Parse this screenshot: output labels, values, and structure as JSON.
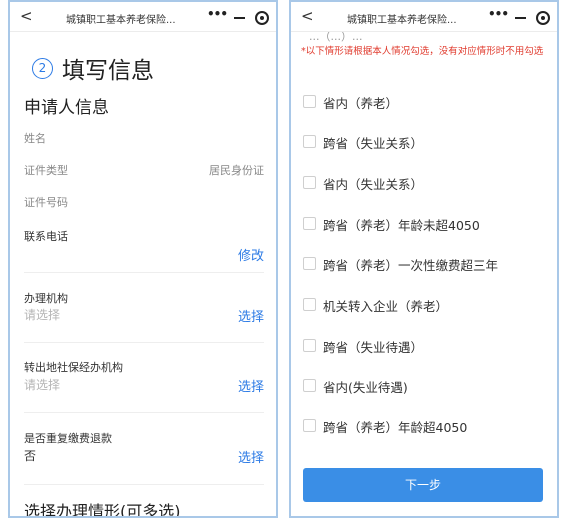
{
  "titlebar": {
    "back_glyph": "<",
    "title": "城镇职工基本养老保险...",
    "more_glyph": "•••"
  },
  "left": {
    "step_number": "2",
    "step_title": "填写信息",
    "section_title": "申请人信息",
    "name_label": "姓名",
    "id_type_label": "证件类型",
    "id_type_value": "居民身份证",
    "id_number_label": "证件号码",
    "phone_label": "联系电话",
    "phone_action": "修改",
    "agency_label": "办理机构",
    "agency_placeholder": "请选择",
    "agency_action": "选择",
    "transfer_agency_label": "转出地社保经办机构",
    "transfer_agency_placeholder": "请选择",
    "transfer_agency_action": "选择",
    "refund_label": "是否重复缴费退款",
    "refund_value": "否",
    "refund_action": "选择",
    "bottom_title": "选择办理情形(可多选)"
  },
  "right": {
    "partial_text": "...（...）...",
    "notice": "*以下情形请根据本人情况勾选，没有对应情形时不用勾选",
    "options": [
      "省内（养老）",
      "跨省（失业关系）",
      "省内（失业关系）",
      "跨省（养老）年龄未超4050",
      "跨省（养老）一次性缴费超三年",
      "机关转入企业（养老）",
      "跨省（失业待遇）",
      "省内(失业待遇)",
      "跨省（养老）年龄超4050"
    ],
    "next_button": "下一步"
  },
  "colors": {
    "accent": "#2d7be5",
    "notice": "#e03b2e",
    "button": "#3a8ee6",
    "frame": "#a9c8e8"
  },
  "icons": [
    "back-icon",
    "more-icon",
    "minimize-icon",
    "close-icon",
    "checkbox-icon"
  ]
}
